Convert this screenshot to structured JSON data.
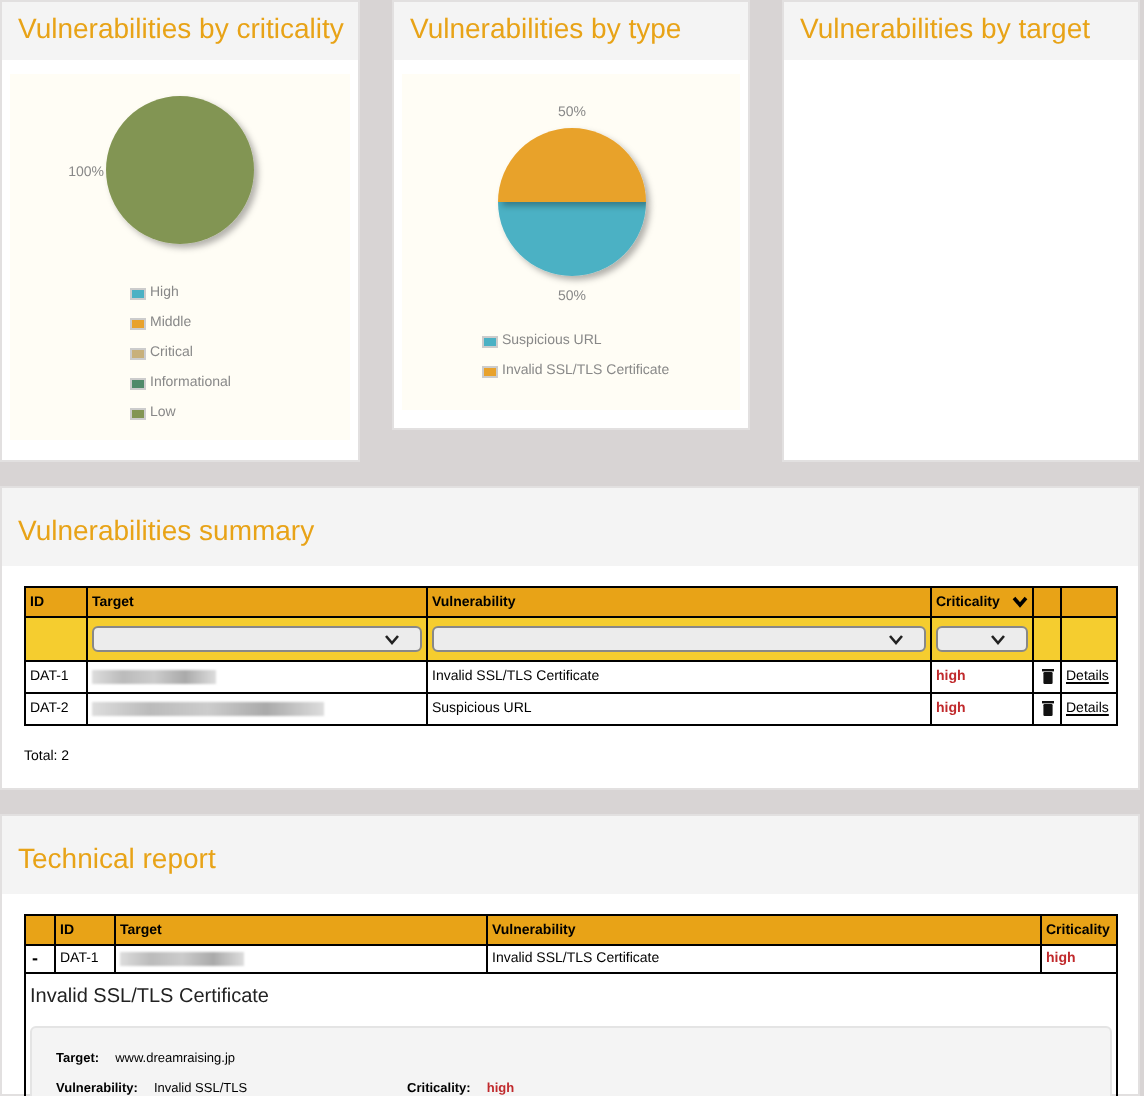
{
  "charts": [
    {
      "title": "Vulnerabilities by criticality",
      "chart_data": {
        "type": "pie",
        "categories": [
          "High",
          "Middle",
          "Critical",
          "Informational",
          "Low"
        ],
        "values": [
          0,
          0,
          0,
          0,
          100
        ],
        "colors": [
          "#4bb1c4",
          "#e8a22c",
          "#c8b07a",
          "#4f8a6a",
          "#829553"
        ],
        "value_labels": [
          null,
          null,
          null,
          null,
          "100%"
        ],
        "legend": true
      }
    },
    {
      "title": "Vulnerabilities by type",
      "chart_data": {
        "type": "pie",
        "categories": [
          "Suspicious URL",
          "Invalid SSL/TLS Certificate"
        ],
        "values": [
          50,
          50
        ],
        "colors": [
          "#4bb1c4",
          "#e8a22c"
        ],
        "value_labels": [
          "50%",
          "50%"
        ],
        "legend": true
      }
    },
    {
      "title": "Vulnerabilities by target"
    }
  ],
  "summary": {
    "title": "Vulnerabilities summary",
    "columns": [
      "ID",
      "Target",
      "Vulnerability",
      "Criticality"
    ],
    "rows": [
      {
        "id": "DAT-1",
        "target_redacted": true,
        "vulnerability": "Invalid SSL/TLS Certificate",
        "criticality": "high",
        "link": "Details"
      },
      {
        "id": "DAT-2",
        "target_redacted": true,
        "vulnerability": "Suspicious URL",
        "criticality": "high",
        "link": "Details"
      }
    ],
    "total": "Total: 2"
  },
  "report": {
    "title": "Technical report",
    "columns": [
      "ID",
      "Target",
      "Vulnerability",
      "Criticality"
    ],
    "rows": [
      {
        "toggle": "-",
        "id": "DAT-1",
        "target_redacted": true,
        "vulnerability": "Invalid SSL/TLS Certificate",
        "criticality": "high",
        "expanded": true
      }
    ],
    "detail": {
      "heading": "Invalid SSL/TLS Certificate",
      "fields": [
        {
          "label": "Target:",
          "value": "www.dreamraising.jp"
        },
        {
          "label": "Vulnerability:",
          "value": "Invalid SSL/TLS"
        },
        {
          "label": "Criticality:",
          "value": "high",
          "kind": "severity"
        }
      ]
    }
  }
}
